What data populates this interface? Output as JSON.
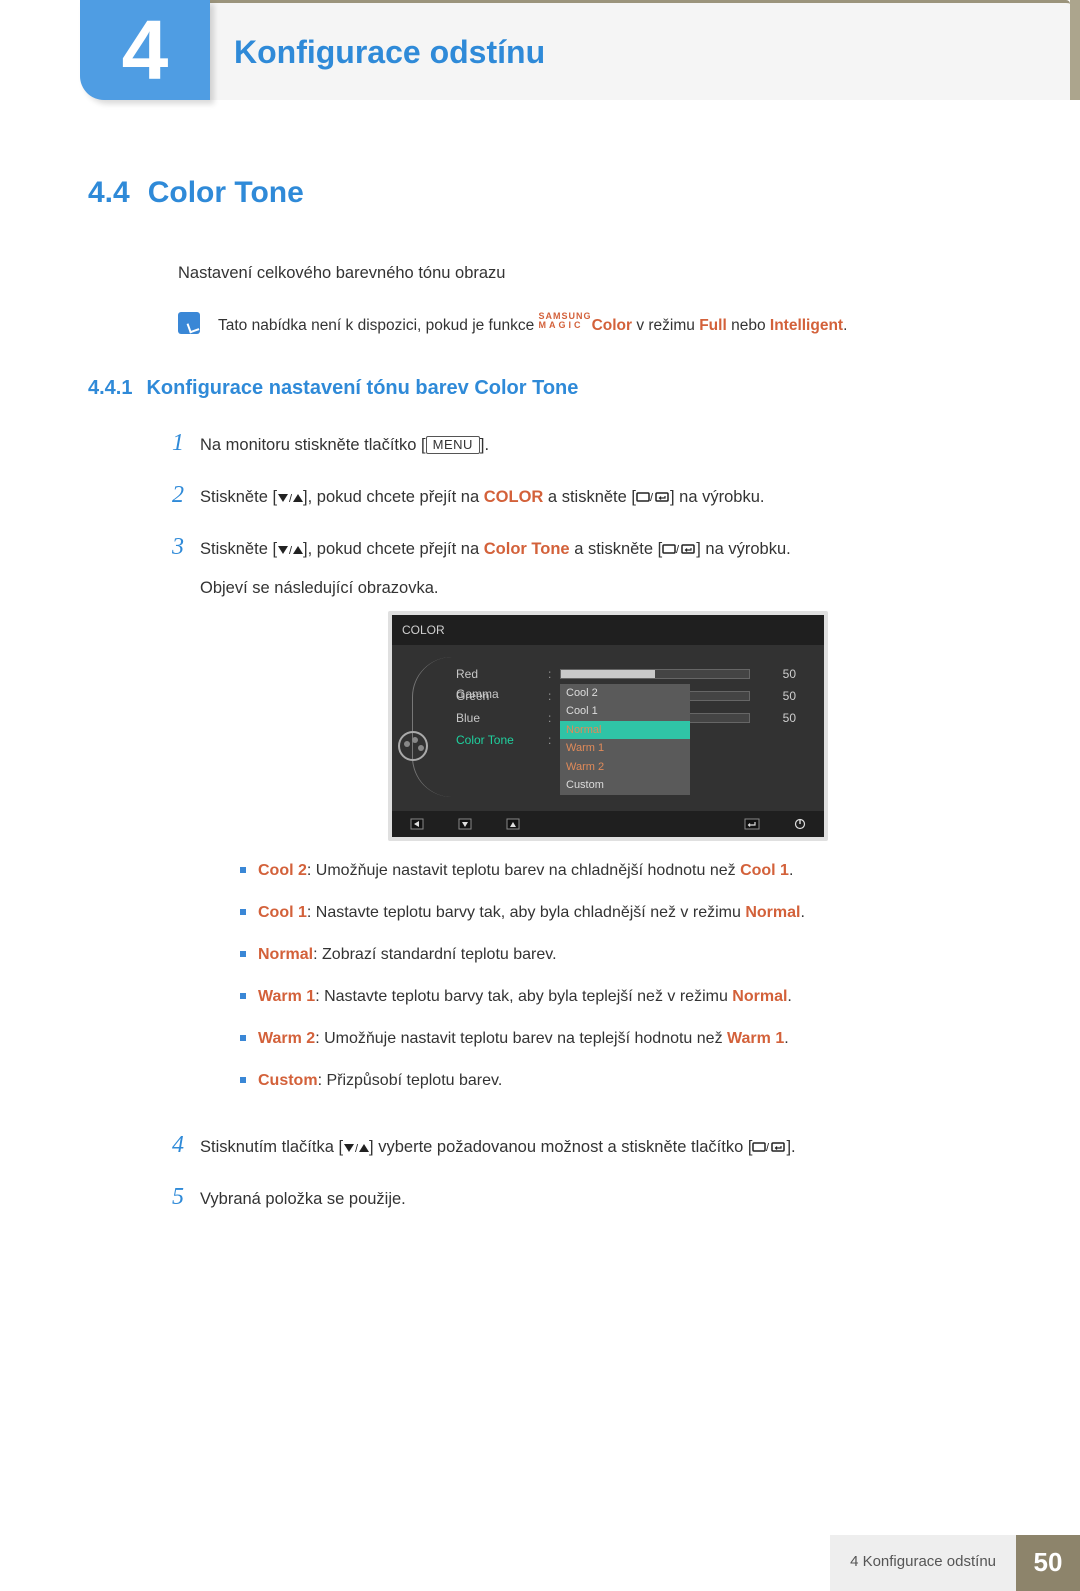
{
  "header": {
    "chapter_number": "4",
    "chapter_title": "Konfigurace odstínu"
  },
  "section": {
    "number": "4.4",
    "title": "Color Tone",
    "intro": "Nastavení celkového barevného tónu obrazu",
    "note_prefix": "Tato nabídka není k dispozici, pokud je funkce ",
    "note_magic_top": "SAMSUNG",
    "note_magic_bottom": "MAGIC",
    "note_magic_label": "Color",
    "note_mid": " v režimu ",
    "note_full": "Full",
    "note_or": " nebo ",
    "note_intelligent": "Intelligent",
    "note_suffix": "."
  },
  "subsection": {
    "number": "4.4.1",
    "title": "Konfigurace nastavení tónu barev Color Tone"
  },
  "steps": {
    "s1_a": "Na monitoru stiskněte tlačítko [",
    "s1_menu": "MENU",
    "s1_b": "].",
    "s2_a": "Stiskněte [",
    "s2_b": "], pokud chcete přejít na ",
    "s2_color": "COLOR",
    "s2_c": " a stiskněte [",
    "s2_d": "] na výrobku.",
    "s3_a": "Stiskněte [",
    "s3_b": "], pokud chcete přejít na ",
    "s3_colortone": "Color Tone",
    "s3_c": " a stiskněte [",
    "s3_d": "] na výrobku.",
    "s3_e": "Objeví se následující obrazovka.",
    "s4_a": "Stisknutím tlačítka [",
    "s4_b": "] vyberte požadovanou možnost a stiskněte tlačítko [",
    "s4_c": "].",
    "s5": "Vybraná položka se použije."
  },
  "osd": {
    "title": "COLOR",
    "rows": [
      {
        "label": "Red",
        "value": 50
      },
      {
        "label": "Green",
        "value": 50
      },
      {
        "label": "Blue",
        "value": 50
      }
    ],
    "color_tone_label": "Color Tone",
    "gamma_label": "Gamma",
    "options": [
      "Cool 2",
      "Cool 1",
      "Normal",
      "Warm 1",
      "Warm 2",
      "Custom"
    ],
    "selected": "Normal"
  },
  "bullets": {
    "b1_k": "Cool 2",
    "b1_t": ": Umožňuje nastavit teplotu barev na chladnější hodnotu než ",
    "b1_r": "Cool 1",
    "b1_s": ".",
    "b2_k": "Cool 1",
    "b2_t": ": Nastavte teplotu barvy tak, aby byla chladnější než v režimu ",
    "b2_r": "Normal",
    "b2_s": ".",
    "b3_k": "Normal",
    "b3_t": ": Zobrazí standardní teplotu barev.",
    "b4_k": "Warm 1",
    "b4_t": ": Nastavte teplotu barvy tak, aby byla teplejší než v režimu ",
    "b4_r": "Normal",
    "b4_s": ".",
    "b5_k": "Warm 2",
    "b5_t": ": Umožňuje nastavit teplotu barev na teplejší hodnotu než ",
    "b5_r": "Warm 1",
    "b5_s": ".",
    "b6_k": "Custom",
    "b6_t": ": Přizpůsobí teplotu barev."
  },
  "footer": {
    "label": "4 Konfigurace odstínu",
    "page": "50"
  }
}
